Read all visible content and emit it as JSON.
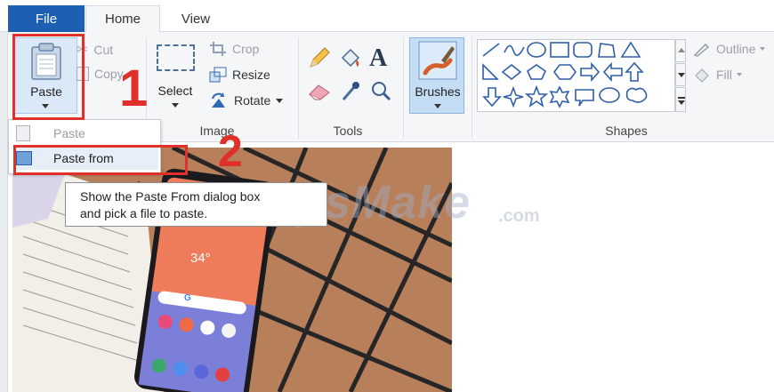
{
  "tabs": {
    "file": "File",
    "home": "Home",
    "view": "View"
  },
  "clipboard": {
    "paste": "Paste",
    "cut": "Cut",
    "copy": "Copy"
  },
  "image": {
    "select": "Select",
    "crop": "Crop",
    "resize": "Resize",
    "rotate": "Rotate",
    "label": "Image"
  },
  "tools": {
    "label": "Tools",
    "text_glyph": "A"
  },
  "brushes": {
    "label": "Brushes"
  },
  "shapes": {
    "label": "Shapes",
    "outline": "Outline",
    "fill": "Fill"
  },
  "dropdown": {
    "paste": "Paste",
    "paste_from": "Paste from"
  },
  "tooltip": {
    "line1": "Show the Paste From dialog box",
    "line2": "and pick a file to paste."
  },
  "annotations": {
    "step1": "1",
    "step2": "2"
  },
  "phone": {
    "time": "34°",
    "search_glyph": "G"
  },
  "watermark": {
    "main": "TipsMake",
    "suffix": ".com"
  },
  "colors": {
    "file_tab": "#1c5fb3",
    "annotation_red": "#e0302a",
    "ribbon_bg": "#f5f6f7"
  },
  "icons": [
    "clipboard-icon",
    "scissors-icon",
    "copy-icon",
    "crop-icon",
    "resize-icon",
    "rotate-icon",
    "pencil-icon",
    "fill-bucket-icon",
    "text-icon",
    "eraser-icon",
    "color-picker-icon",
    "magnifier-icon",
    "brush-icon",
    "outline-icon",
    "fill-icon"
  ]
}
